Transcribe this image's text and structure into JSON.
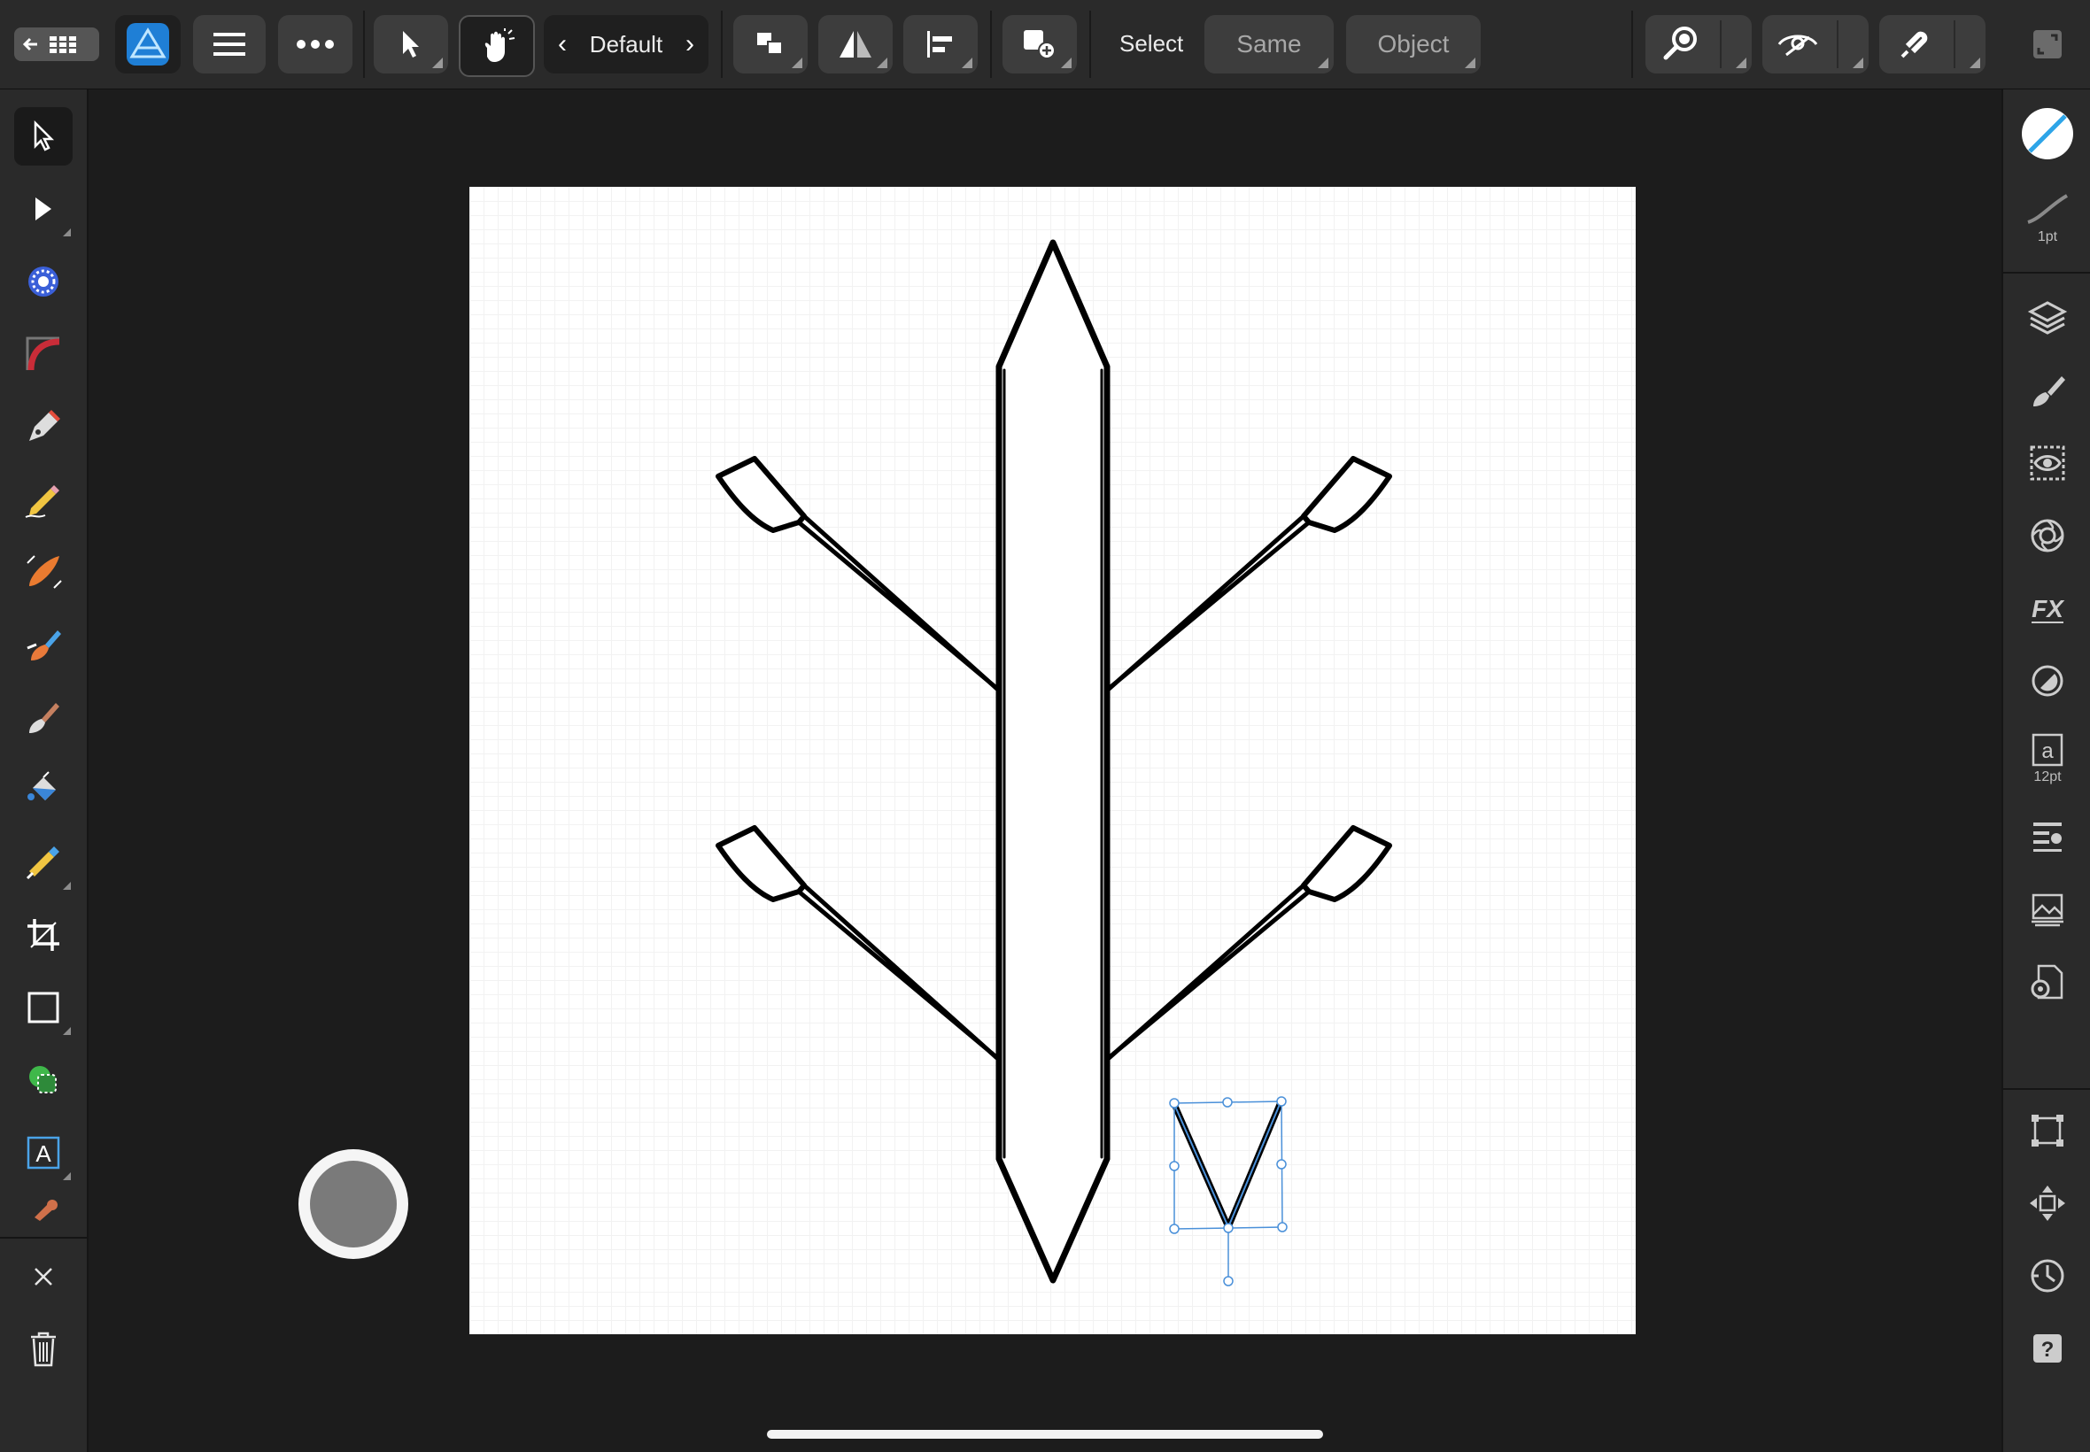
{
  "app": "Affinity Designer",
  "topbar": {
    "back_icon": "back-grid-icon",
    "style_label": "Default",
    "select_label": "Select",
    "same_label": "Same",
    "object_label": "Object"
  },
  "left_tools": [
    "move-tool",
    "node-tool",
    "contour-tool",
    "corner-tool",
    "pen-tool",
    "pencil-tool",
    "vector-brush-tool",
    "fill-tool",
    "transparency-tool",
    "pixel-brush-tool",
    "paint-brush-tool",
    "erase-tool",
    "crop-tool",
    "rectangle-tool",
    "shape-builder-tool",
    "frame-text-tool",
    "color-picker-tool"
  ],
  "right_panel": {
    "stroke_width": "1pt",
    "text_size": "12pt"
  },
  "colors": {
    "accent": "#2ea5e8",
    "selection": "#4a90d9",
    "panel": "#2a2a2a",
    "background": "#1c1c1c"
  }
}
